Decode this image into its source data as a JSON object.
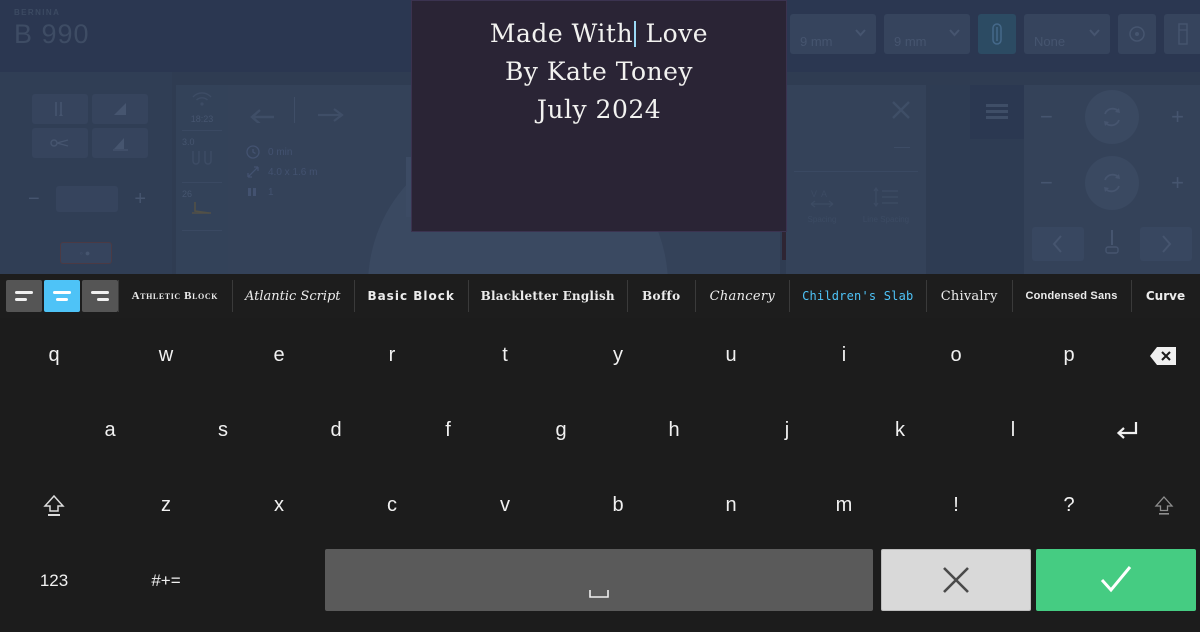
{
  "background_app": {
    "brand": {
      "name": "BERNINA",
      "model": "B 990"
    },
    "toolbar": {
      "selects": [
        {
          "label": "",
          "value": "9 mm",
          "name": "stitch-width-select"
        },
        {
          "label": "",
          "value": "9 mm",
          "name": "needle-plate-select"
        },
        {
          "label": "",
          "value": "None",
          "name": "presser-foot-select"
        }
      ],
      "icons": [
        "needle-icon",
        "eco-icon",
        "usb-drive-icon"
      ]
    },
    "status": {
      "time": "18:23",
      "stitch_width": "3.0",
      "foot_number": "26"
    },
    "canvas_metrics": {
      "time_label": "0 min",
      "size_label": "4.0 x 1.6 m",
      "color_count": "1"
    },
    "tools": [
      {
        "label": "Spacing",
        "icon": "letter-spacing-icon"
      },
      {
        "label": "Line Spacing",
        "icon": "line-spacing-icon"
      }
    ]
  },
  "text_preview": {
    "lines_before_caret": "Made With",
    "line1_after_caret": " Love",
    "line2": "By Kate Toney",
    "line3": "July 2024",
    "background_color": "#2a2435",
    "text_color": "#f2f2f0",
    "caret_color": "#9bd9f5"
  },
  "font_bar": {
    "accent_color": "#4ec3f7",
    "alignment": {
      "selected": "center",
      "options": [
        {
          "name": "align-left",
          "label": "Align Left"
        },
        {
          "name": "align-center",
          "label": "Align Center"
        },
        {
          "name": "align-right",
          "label": "Align Right"
        }
      ]
    },
    "fonts": [
      {
        "label": "Athletic Block",
        "face": "f-athletic",
        "selected": false
      },
      {
        "label": "Atlantic Script",
        "face": "f-atlantic",
        "selected": false
      },
      {
        "label": "Basic Block",
        "face": "f-basic",
        "selected": false
      },
      {
        "label": "Blackletter English",
        "face": "f-black",
        "selected": false
      },
      {
        "label": "Boffo",
        "face": "f-boffo",
        "selected": false
      },
      {
        "label": "Chancery",
        "face": "f-chancery",
        "selected": false
      },
      {
        "label": "Children's Slab",
        "face": "f-children",
        "selected": true
      },
      {
        "label": "Chivalry",
        "face": "f-chivalry",
        "selected": false
      },
      {
        "label": "Condensed Sans",
        "face": "f-condensed",
        "selected": false
      },
      {
        "label": "Curve",
        "face": "f-curve",
        "selected": false
      }
    ]
  },
  "keyboard": {
    "row1": [
      "q",
      "w",
      "e",
      "r",
      "t",
      "y",
      "u",
      "i",
      "o",
      "p"
    ],
    "row1_action": {
      "name": "backspace-key",
      "icon": "backspace-icon"
    },
    "row2": [
      "a",
      "s",
      "d",
      "f",
      "g",
      "h",
      "j",
      "k",
      "l"
    ],
    "row2_action": {
      "name": "enter-key",
      "icon": "return-icon"
    },
    "row3_shift_left": {
      "name": "shift-key-left",
      "icon": "shift-icon"
    },
    "row3": [
      "z",
      "x",
      "c",
      "v",
      "b",
      "n",
      "m",
      "!",
      "?"
    ],
    "row3_shift_right": {
      "name": "shift-key-right",
      "icon": "shift-icon"
    },
    "row4": {
      "numeric_label": "123",
      "symbols_label": "#+=",
      "space_label": "",
      "cancel_label": "",
      "confirm_label": ""
    },
    "colors": {
      "spacebar": "#5a5a5a",
      "cancel": "#d9d9d9",
      "confirm": "#45cc82"
    }
  }
}
